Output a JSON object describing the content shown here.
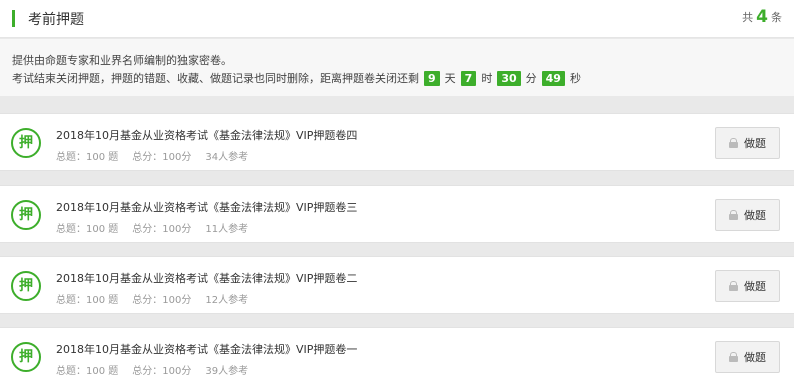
{
  "header": {
    "title": "考前押题",
    "count_prefix": "共",
    "count": "4",
    "count_suffix": "条"
  },
  "notice": {
    "line1": "提供由命题专家和业界名师编制的独家密卷。",
    "line2_prefix": "考试结束关闭押题，押题的错题、收藏、做题记录也同时删除，距离押题卷关闭还剩",
    "countdown": {
      "days": "9",
      "days_unit": "天",
      "hours": "7",
      "hours_unit": "时",
      "minutes": "30",
      "minutes_unit": "分",
      "seconds": "49",
      "seconds_unit": "秒"
    }
  },
  "exams": [
    {
      "badge": "押",
      "title": "2018年10月基金从业资格考试《基金法律法规》VIP押题卷四",
      "questions": "总题：100 题",
      "score": "总分：100分",
      "participants": "34人参考",
      "button": "做题"
    },
    {
      "badge": "押",
      "title": "2018年10月基金从业资格考试《基金法律法规》VIP押题卷三",
      "questions": "总题：100 题",
      "score": "总分：100分",
      "participants": "11人参考",
      "button": "做题"
    },
    {
      "badge": "押",
      "title": "2018年10月基金从业资格考试《基金法律法规》VIP押题卷二",
      "questions": "总题：100 题",
      "score": "总分：100分",
      "participants": "12人参考",
      "button": "做题"
    },
    {
      "badge": "押",
      "title": "2018年10月基金从业资格考试《基金法律法规》VIP押题卷一",
      "questions": "总题：100 题",
      "score": "总分：100分",
      "participants": "39人参考",
      "button": "做题"
    }
  ],
  "colors": {
    "accent": "#3dae2b"
  }
}
